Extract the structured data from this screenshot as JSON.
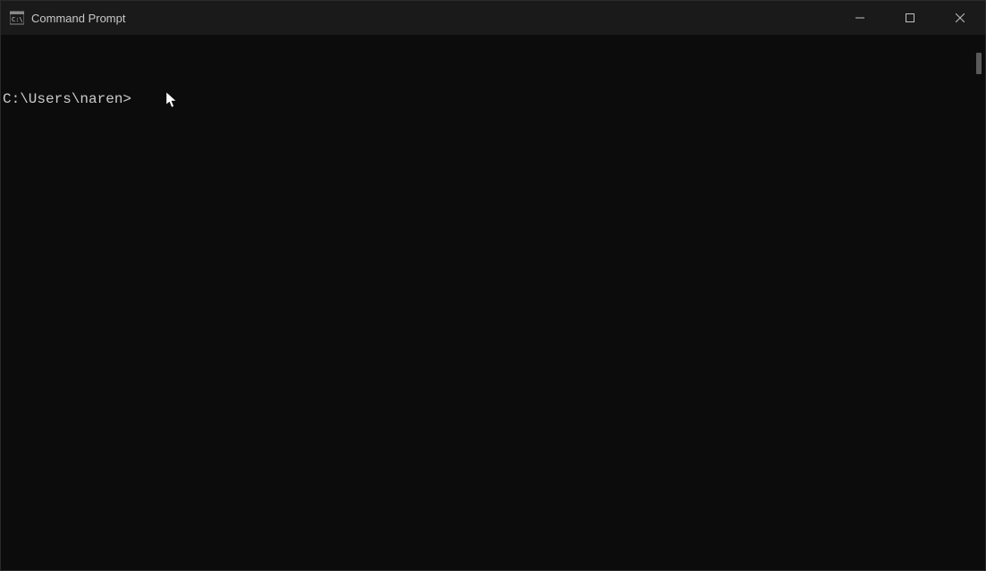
{
  "window": {
    "title": "Command Prompt"
  },
  "terminal": {
    "prompt": "C:\\Users\\naren>"
  }
}
